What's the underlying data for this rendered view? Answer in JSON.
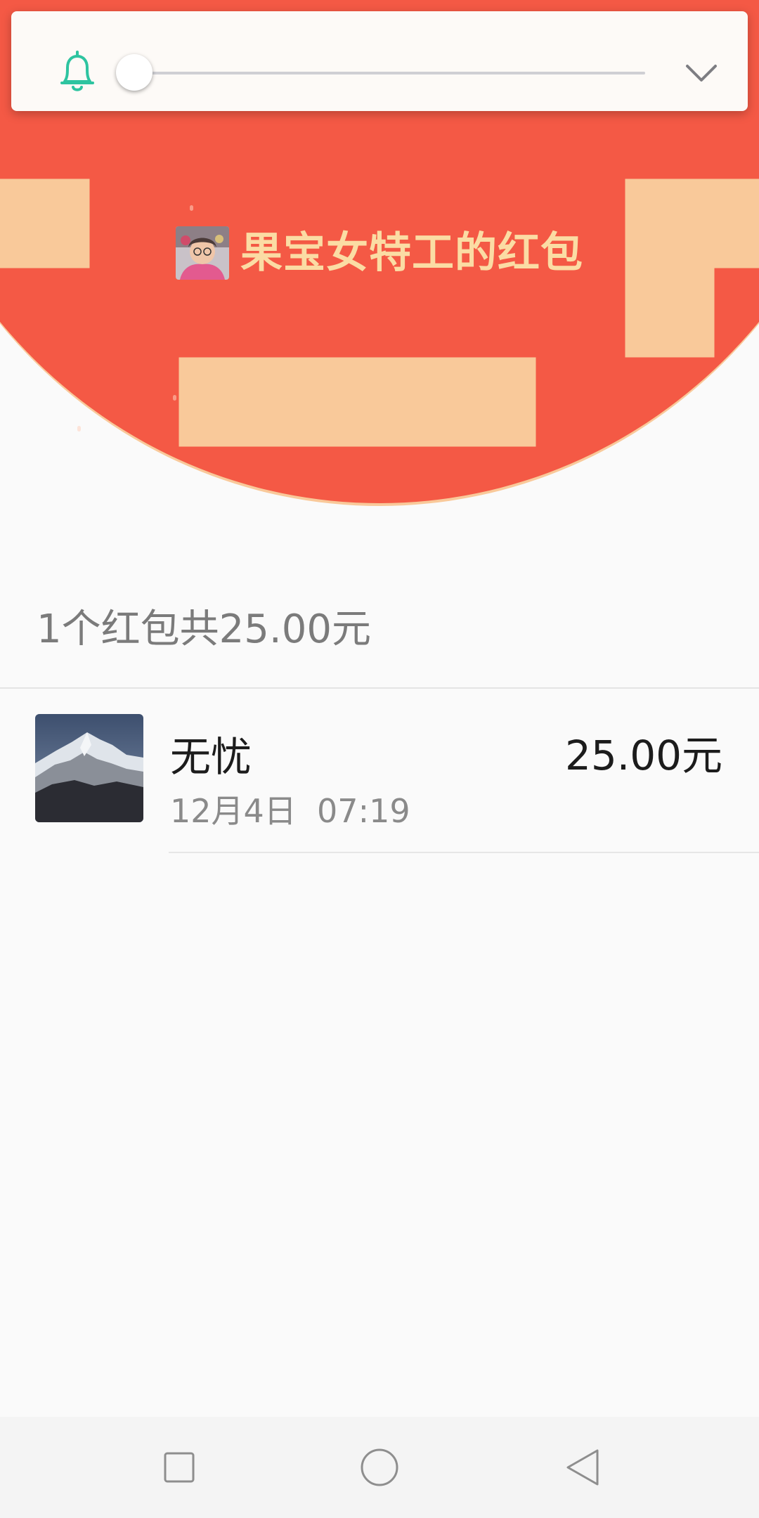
{
  "volume_panel": {
    "level": 0.02,
    "icon": "bell-icon",
    "expand_icon": "chevron-down-icon",
    "accent_color": "#2ec4a0"
  },
  "header": {
    "sender_title": "果宝女特工的红包",
    "background_color": "#f45945",
    "title_color": "#fbdca4"
  },
  "summary": {
    "text": "1个红包共25.00元"
  },
  "receivers": [
    {
      "name": "无忧",
      "time": "12月4日  07:19",
      "amount": "25.00元"
    }
  ],
  "nav": {
    "buttons": [
      "recents-button",
      "home-button",
      "back-button"
    ]
  }
}
